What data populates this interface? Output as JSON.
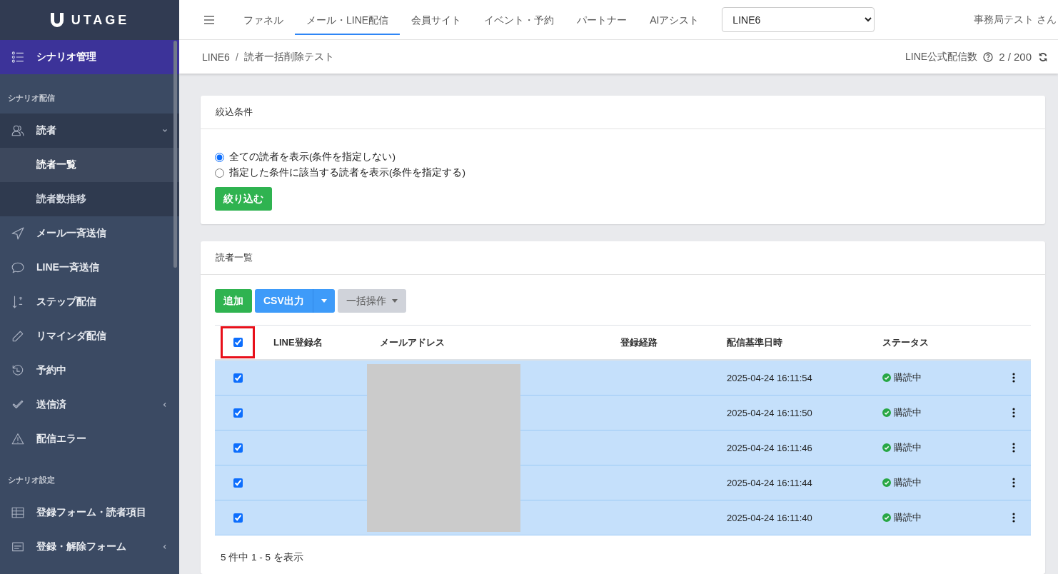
{
  "sidebar": {
    "logo": "UTAGE",
    "title": {
      "label": "シナリオ管理",
      "selected": true
    },
    "sections": [
      {
        "heading": "シナリオ配信",
        "items": [
          {
            "label": "読者",
            "selected": false,
            "expanded": true,
            "children": [
              {
                "label": "読者一覧",
                "selected": true
              },
              {
                "label": "読者数推移",
                "selected": false
              }
            ]
          },
          {
            "label": "メール一斉送信",
            "selected": false
          },
          {
            "label": "LINE一斉送信",
            "selected": false
          },
          {
            "label": "ステップ配信",
            "selected": false
          },
          {
            "label": "リマインダ配信",
            "selected": false
          },
          {
            "label": "予約中",
            "selected": false
          },
          {
            "label": "送信済",
            "selected": false,
            "expanded": false
          },
          {
            "label": "配信エラー",
            "selected": false
          }
        ]
      },
      {
        "heading": "シナリオ設定",
        "items": [
          {
            "label": "登録フォーム・読者項目",
            "selected": false
          },
          {
            "label": "登録・解除フォーム",
            "selected": false,
            "expanded": false
          }
        ]
      }
    ]
  },
  "topnav": {
    "tabs": [
      {
        "label": "ファネル",
        "selected": false
      },
      {
        "label": "メール・LINE配信",
        "selected": true
      },
      {
        "label": "会員サイト",
        "selected": false
      },
      {
        "label": "イベント・予約",
        "selected": false
      },
      {
        "label": "パートナー",
        "selected": false
      },
      {
        "label": "AIアシスト",
        "selected": false
      }
    ],
    "account_select": "LINE6",
    "user": "事務局テスト さん"
  },
  "breadcrumb": {
    "items": [
      "LINE6",
      "読者一括削除テスト"
    ],
    "separator": "/"
  },
  "quota": {
    "label": "LINE公式配信数",
    "value": "2 / 200"
  },
  "filter_card": {
    "title": "絞込条件",
    "options": [
      {
        "label": "全ての読者を表示(条件を指定しない)",
        "selected": true
      },
      {
        "label": "指定した条件に該当する読者を表示(条件を指定する)",
        "selected": false
      }
    ],
    "button": "絞り込む"
  },
  "readers_card": {
    "title": "読者一覧",
    "buttons": {
      "add": "追加",
      "csv": "CSV出力",
      "bulk": "一括操作"
    },
    "table": {
      "header_checkbox": {
        "checked": true,
        "highlighted": true
      },
      "email_redacted": true,
      "columns": [
        "LINE登録名",
        "メールアドレス",
        "登録経路",
        "配信基準日時",
        "ステータス"
      ],
      "rows": [
        {
          "checked": true,
          "date": "2025-04-24 16:11:54",
          "status": "購読中"
        },
        {
          "checked": true,
          "date": "2025-04-24 16:11:50",
          "status": "購読中"
        },
        {
          "checked": true,
          "date": "2025-04-24 16:11:46",
          "status": "購読中"
        },
        {
          "checked": true,
          "date": "2025-04-24 16:11:44",
          "status": "購読中"
        },
        {
          "checked": true,
          "date": "2025-04-24 16:11:40",
          "status": "購読中"
        }
      ]
    },
    "footer": "5 件中 1 - 5 を表示"
  }
}
